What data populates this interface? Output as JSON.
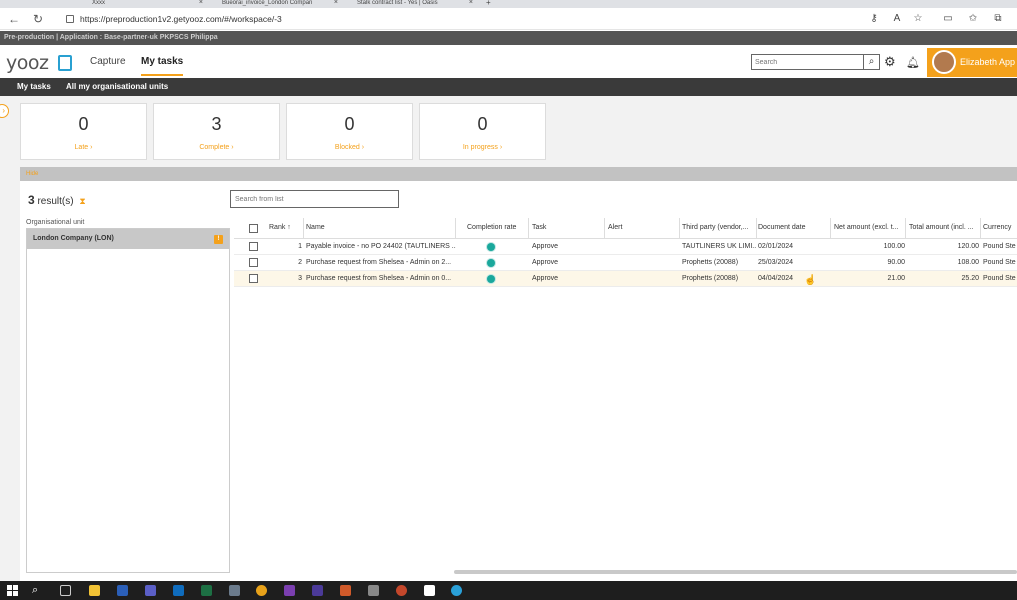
{
  "browser": {
    "tabs": [
      {
        "label": "Xxxx"
      },
      {
        "label": "Bueorai_invoice_London Compan"
      },
      {
        "label": "Stalk contract list - Yes | Oasis"
      }
    ],
    "url": "https://preproduction1v2.getyooz.com/#/workspace/-3"
  },
  "env_banner": "Pre-production | Application : Base-partner-uk PKPSCS Philippa",
  "header": {
    "logo": "yooz",
    "nav": [
      "Capture",
      "My tasks"
    ],
    "search_placeholder": "Search",
    "user_name": "Elizabeth App"
  },
  "subnav": [
    "My tasks",
    "All my organisational units"
  ],
  "kpis": [
    {
      "value": "0",
      "label": "Late"
    },
    {
      "value": "3",
      "label": "Complete"
    },
    {
      "value": "0",
      "label": "Blocked"
    },
    {
      "value": "0",
      "label": "In progress"
    }
  ],
  "section_label": "Hide",
  "results": {
    "count": "3",
    "suffix": "result(s)"
  },
  "list_search_placeholder": "Search from list",
  "org_unit": {
    "label": "Organisational unit",
    "item": "London Company (LON)",
    "badge": "!"
  },
  "table": {
    "columns": {
      "rank": "Rank",
      "name": "Name",
      "completion": "Completion rate",
      "task": "Task",
      "alert": "Alert",
      "third_party": "Third party (vendor,...",
      "doc_date": "Document date",
      "net": "Net amount (excl. t...",
      "total": "Total amount (incl. ...",
      "currency": "Currency"
    },
    "rows": [
      {
        "rank": "1",
        "name": "Payable invoice - no PO 24402 (TAUTLINERS ...",
        "task": "Approve",
        "third_party": "TAUTLINERS UK LIMI...",
        "doc_date": "02/01/2024",
        "net": "100.00",
        "total": "120.00",
        "currency": "Pound Ste"
      },
      {
        "rank": "2",
        "name": "Purchase request from Shelsea - Admin on 2...",
        "task": "Approve",
        "third_party": "Prophetts (20088)",
        "doc_date": "25/03/2024",
        "net": "90.00",
        "total": "108.00",
        "currency": "Pound Ste"
      },
      {
        "rank": "3",
        "name": "Purchase request from Shelsea - Admin on 0...",
        "task": "Approve",
        "third_party": "Prophetts (20088)",
        "doc_date": "04/04/2024",
        "net": "21.00",
        "total": "25.20",
        "currency": "Pound Ste"
      }
    ]
  },
  "colors": {
    "accent": "#f4a11b",
    "completion_dot": "#1aa89c",
    "dark_bar": "#3a3a3a"
  }
}
